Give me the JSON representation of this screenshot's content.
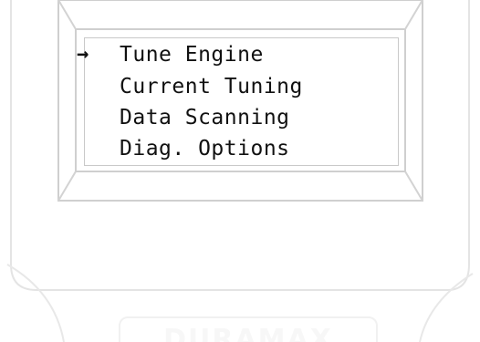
{
  "menu": {
    "cursor_glyph": "→",
    "selected_index": 0,
    "items": [
      {
        "label": "Tune Engine"
      },
      {
        "label": "Current Tuning"
      },
      {
        "label": "Data Scanning"
      },
      {
        "label": "Diag. Options"
      }
    ]
  },
  "device": {
    "brand_logo_text": "DURAMAX"
  },
  "colors": {
    "text": "#111111",
    "bezel_stroke": "#d0d0d0",
    "body_stroke": "#e4e4e4",
    "background": "#ffffff"
  }
}
